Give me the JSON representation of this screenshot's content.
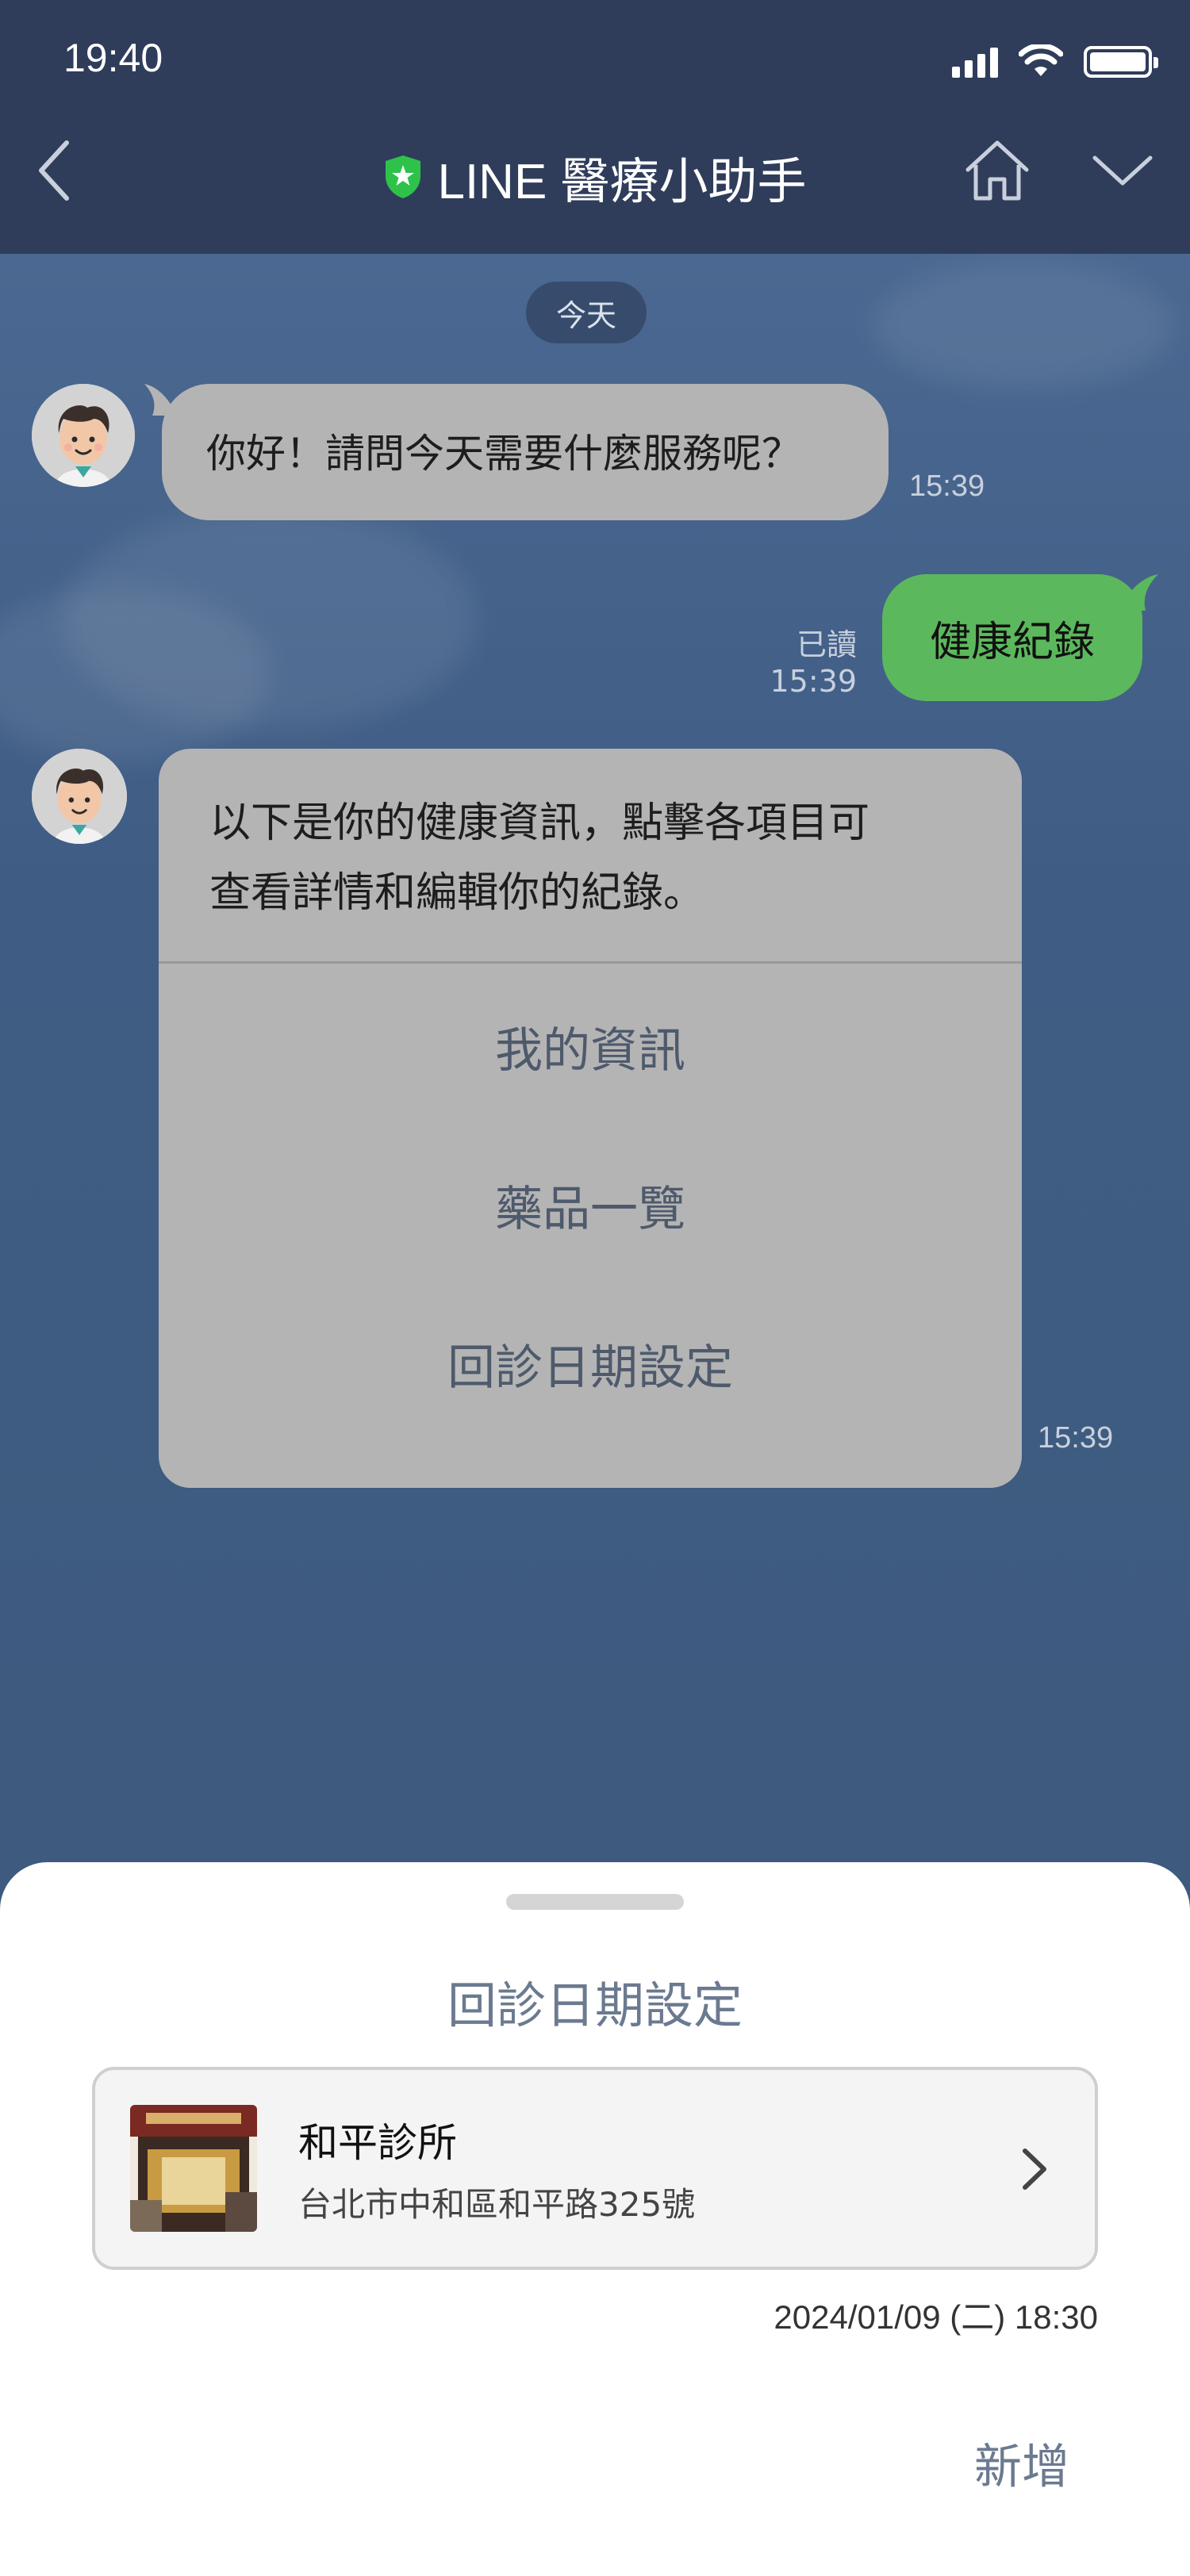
{
  "status_bar": {
    "time": "19:40"
  },
  "header": {
    "title": "LINE 醫療小助手",
    "back_icon": "chevron-left-icon",
    "home_icon": "home-icon",
    "dropdown_icon": "chevron-down-icon",
    "verified_icon": "shield-star-icon",
    "colors": {
      "background": "#2f3d5b",
      "verified": "#2ec24a"
    }
  },
  "chat": {
    "date_divider": "今天",
    "messages": [
      {
        "from": "bot",
        "text": "你好！請問今天需要什麼服務呢？",
        "time": "15:39"
      },
      {
        "from": "user",
        "text": "健康紀錄",
        "read_label": "已讀",
        "time": "15:39"
      },
      {
        "from": "bot",
        "text_line1": "以下是你的健康資訊，點擊各項目可",
        "text_line2": "查看詳情和編輯你的紀錄。",
        "options": [
          "我的資訊",
          "藥品一覽",
          "回診日期設定"
        ],
        "time": "15:39"
      }
    ],
    "colors": {
      "bot_bubble": "#b4b4b4",
      "user_bubble": "#5cb85c"
    }
  },
  "sheet": {
    "title": "回診日期設定",
    "clinic": {
      "name": "和平診所",
      "address": "台北市中和區和平路325號"
    },
    "appointment_time": "2024/01/09 (二) 18:30",
    "add_label": "新增"
  }
}
